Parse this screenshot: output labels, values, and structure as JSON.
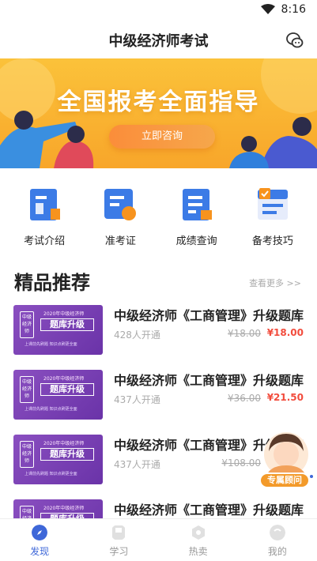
{
  "status_bar": {
    "time": "8:16"
  },
  "header": {
    "title": "中级经济师考试",
    "chat_icon": "chat-bubbles-icon"
  },
  "banner": {
    "title": "全国报考全面指导",
    "button_label": "立即咨询"
  },
  "quick_links": [
    {
      "label": "考试介绍",
      "icon": "exam-intro-icon"
    },
    {
      "label": "准考证",
      "icon": "admission-ticket-icon"
    },
    {
      "label": "成绩查询",
      "icon": "score-query-icon"
    },
    {
      "label": "备考技巧",
      "icon": "study-tips-icon"
    }
  ],
  "section": {
    "title": "精品推荐",
    "see_more": "查看更多 >>"
  },
  "thumbnail": {
    "top_text": "2020年中级经济师",
    "badge_text": "题库升级",
    "seal_text": "中级经济师",
    "bottom_text": "上课前先刷题 知识点刷更全面"
  },
  "courses": [
    {
      "title": "中级经济师《工商管理》升级题库",
      "count": "428人开通",
      "old_price": "¥18.00",
      "price": "¥18.00"
    },
    {
      "title": "中级经济师《工商管理》升级题库",
      "count": "437人开通",
      "old_price": "¥36.00",
      "price": "¥21.50"
    },
    {
      "title": "中级经济师《工商管理》升级题库",
      "count": "437人开通",
      "old_price": "¥108.00",
      "price": ""
    },
    {
      "title": "中级经济师《工商管理》升级题库",
      "count": "",
      "old_price": "",
      "price": ""
    }
  ],
  "advisor": {
    "label": "专属顾问"
  },
  "tabs": [
    {
      "label": "发现",
      "active": true
    },
    {
      "label": "学习",
      "active": false
    },
    {
      "label": "热卖",
      "active": false
    },
    {
      "label": "我的",
      "active": false
    }
  ],
  "colors": {
    "accent": "#3e67d8",
    "price": "#f24c3d",
    "banner": "#fbc23a",
    "thumb": "#7a40b4"
  }
}
